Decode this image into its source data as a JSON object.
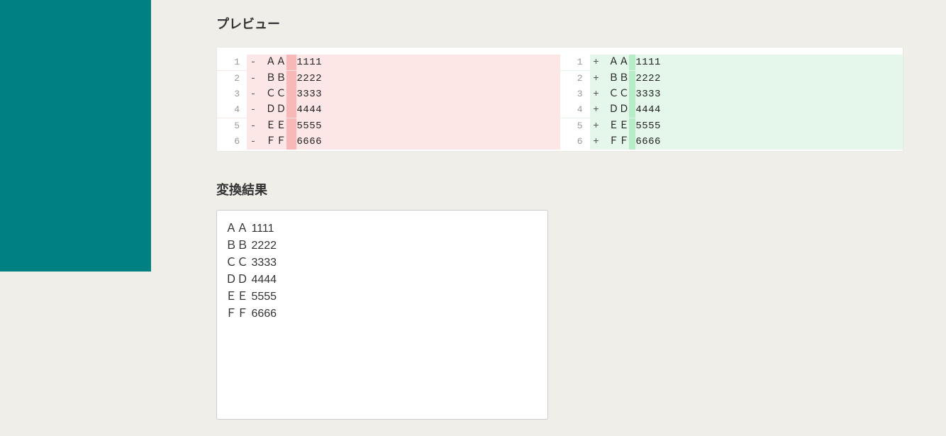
{
  "preview": {
    "heading": "プレビュー",
    "removed": [
      {
        "lineno": "1",
        "sign": "-",
        "before": "ＡＡ",
        "highlight": "　",
        "after": "1111"
      },
      {
        "lineno": "2",
        "sign": "-",
        "before": "ＢＢ",
        "highlight": "　",
        "after": "2222"
      },
      {
        "lineno": "3",
        "sign": "-",
        "before": "ＣＣ",
        "highlight": "　",
        "after": "3333"
      },
      {
        "lineno": "4",
        "sign": "-",
        "before": "ＤＤ",
        "highlight": "　",
        "after": "4444"
      },
      {
        "lineno": "5",
        "sign": "-",
        "before": "ＥＥ",
        "highlight": "　",
        "after": "5555"
      },
      {
        "lineno": "6",
        "sign": "-",
        "before": "ＦＦ",
        "highlight": "　",
        "after": "6666"
      }
    ],
    "added": [
      {
        "lineno": "1",
        "sign": "+",
        "before": "ＡＡ",
        "highlight": " ",
        "after": "1111"
      },
      {
        "lineno": "2",
        "sign": "+",
        "before": "ＢＢ",
        "highlight": " ",
        "after": "2222"
      },
      {
        "lineno": "3",
        "sign": "+",
        "before": "ＣＣ",
        "highlight": " ",
        "after": "3333"
      },
      {
        "lineno": "4",
        "sign": "+",
        "before": "ＤＤ",
        "highlight": " ",
        "after": "4444"
      },
      {
        "lineno": "5",
        "sign": "+",
        "before": "ＥＥ",
        "highlight": " ",
        "after": "5555"
      },
      {
        "lineno": "6",
        "sign": "+",
        "before": "ＦＦ",
        "highlight": " ",
        "after": "6666"
      }
    ]
  },
  "result": {
    "heading": "変換結果",
    "text": "ＡＡ 1111\nＢＢ 2222\nＣＣ 3333\nＤＤ 4444\nＥＥ 5555\nＦＦ 6666"
  }
}
